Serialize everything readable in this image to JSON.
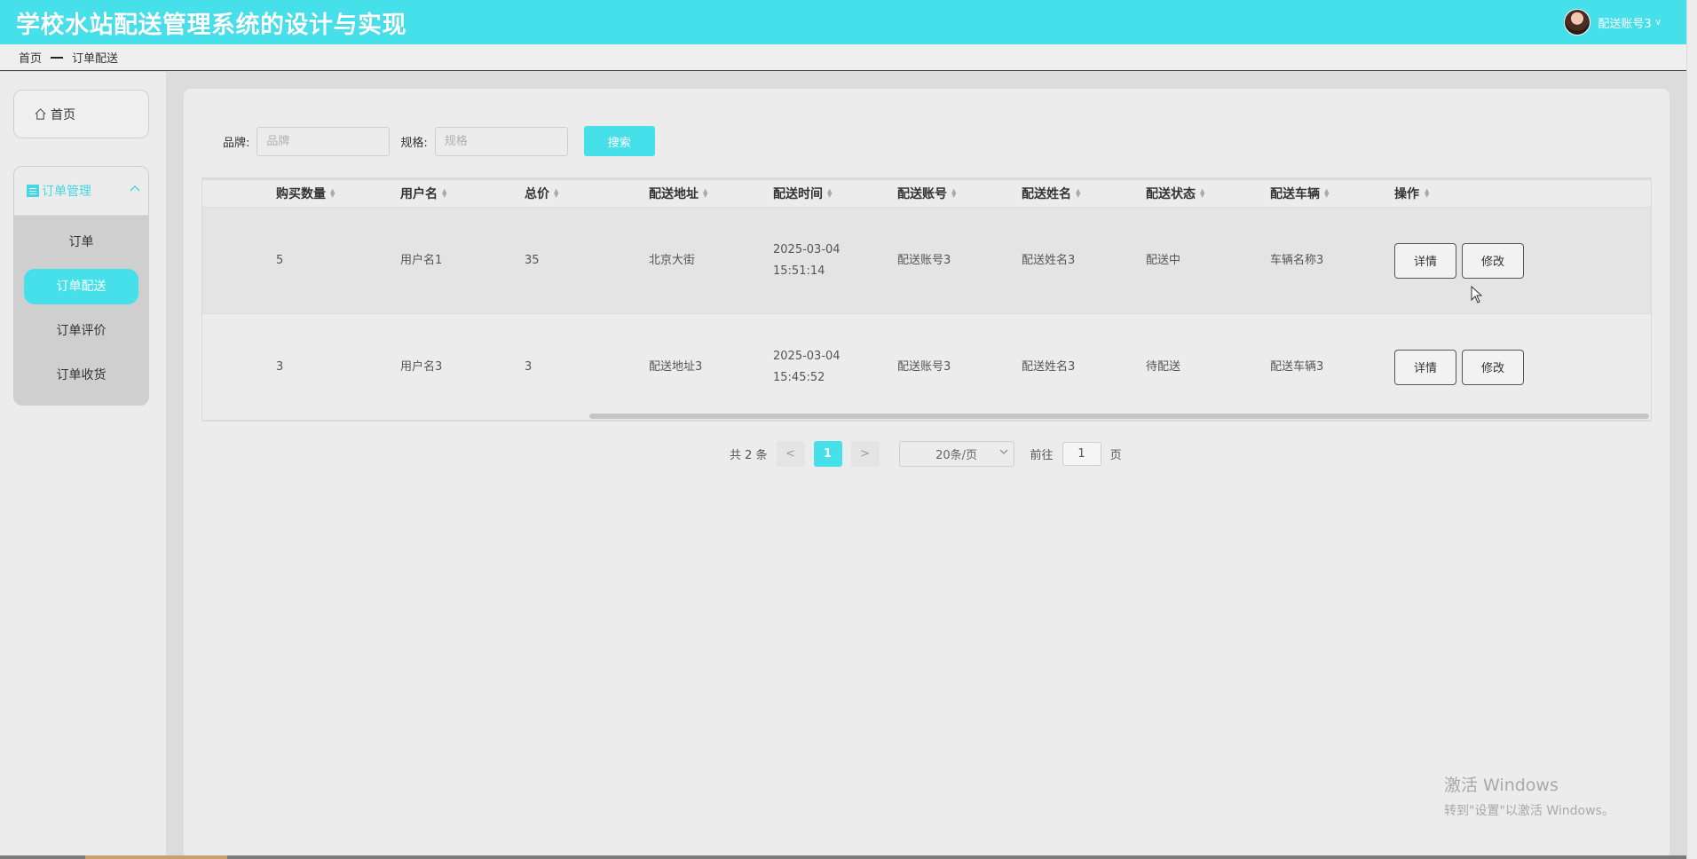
{
  "header": {
    "title": "学校水站配送管理系统的设计与实现",
    "user_name": "配送账号3",
    "user_caret": "∨"
  },
  "breadcrumb": {
    "home": "首页",
    "current": "订单配送"
  },
  "sidebar": {
    "home_label": "首页",
    "group_label": "订单管理",
    "items": [
      {
        "label": "订单",
        "active": false
      },
      {
        "label": "订单配送",
        "active": true
      },
      {
        "label": "订单评价",
        "active": false
      },
      {
        "label": "订单收货",
        "active": false
      }
    ]
  },
  "search": {
    "brand_label": "品牌:",
    "brand_placeholder": "品牌",
    "spec_label": "规格:",
    "spec_placeholder": "规格",
    "button_label": "搜索"
  },
  "table": {
    "columns": [
      "购买数量",
      "用户名",
      "总价",
      "配送地址",
      "配送时间",
      "配送账号",
      "配送姓名",
      "配送状态",
      "配送车辆",
      "操作"
    ],
    "rows": [
      {
        "qty": "5",
        "user": "用户名1",
        "total": "35",
        "address": "北京大街",
        "time": "2025-03-04 15:51:14",
        "account": "配送账号3",
        "name": "配送姓名3",
        "status": "配送中",
        "vehicle": "车辆名称3"
      },
      {
        "qty": "3",
        "user": "用户名3",
        "total": "3",
        "address": "配送地址3",
        "time": "2025-03-04 15:45:52",
        "account": "配送账号3",
        "name": "配送姓名3",
        "status": "待配送",
        "vehicle": "配送车辆3"
      }
    ],
    "detail_label": "详情",
    "edit_label": "修改"
  },
  "pagination": {
    "total_text": "共 2 条",
    "prev": "<",
    "current_page": "1",
    "next": ">",
    "page_size": "20条/页",
    "goto_label": "前往",
    "goto_value": "1",
    "page_unit": "页"
  },
  "watermark": {
    "title": "激活 Windows",
    "subtitle": "转到\"设置\"以激活 Windows。"
  },
  "colors": {
    "accent": "#45e0ea"
  }
}
